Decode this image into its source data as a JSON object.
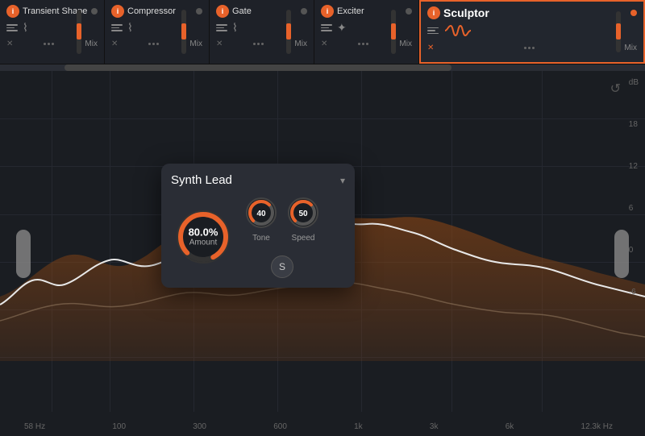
{
  "toolbar": {
    "plugins": [
      {
        "id": 1,
        "name": "Transient Shaper",
        "active": false,
        "mix_label": "Mix"
      },
      {
        "id": 1,
        "name": "Compressor",
        "active": false,
        "mix_label": "Mix"
      },
      {
        "id": 1,
        "name": "Gate",
        "active": false,
        "mix_label": "Mix"
      },
      {
        "id": 1,
        "name": "Exciter",
        "active": false,
        "mix_label": "Mix"
      }
    ],
    "sculptor": {
      "name": "Sculptor",
      "mix_label": "Mix",
      "active": true
    }
  },
  "popup": {
    "preset_name": "Synth Lead",
    "chevron": "▾",
    "amount": {
      "value": "80.0%",
      "label": "Amount"
    },
    "tone": {
      "value": "40",
      "label": "Tone"
    },
    "speed": {
      "value": "50",
      "label": "Speed"
    },
    "s_button": "S"
  },
  "freq_labels": [
    "58 Hz",
    "100",
    "300",
    "600",
    "1k",
    "3k",
    "6k",
    "12.3k Hz"
  ],
  "db_labels": [
    "dB",
    "18",
    "12",
    "6",
    "0",
    "-6"
  ],
  "icons": {
    "refresh": "↺",
    "x_mark": "✕"
  }
}
